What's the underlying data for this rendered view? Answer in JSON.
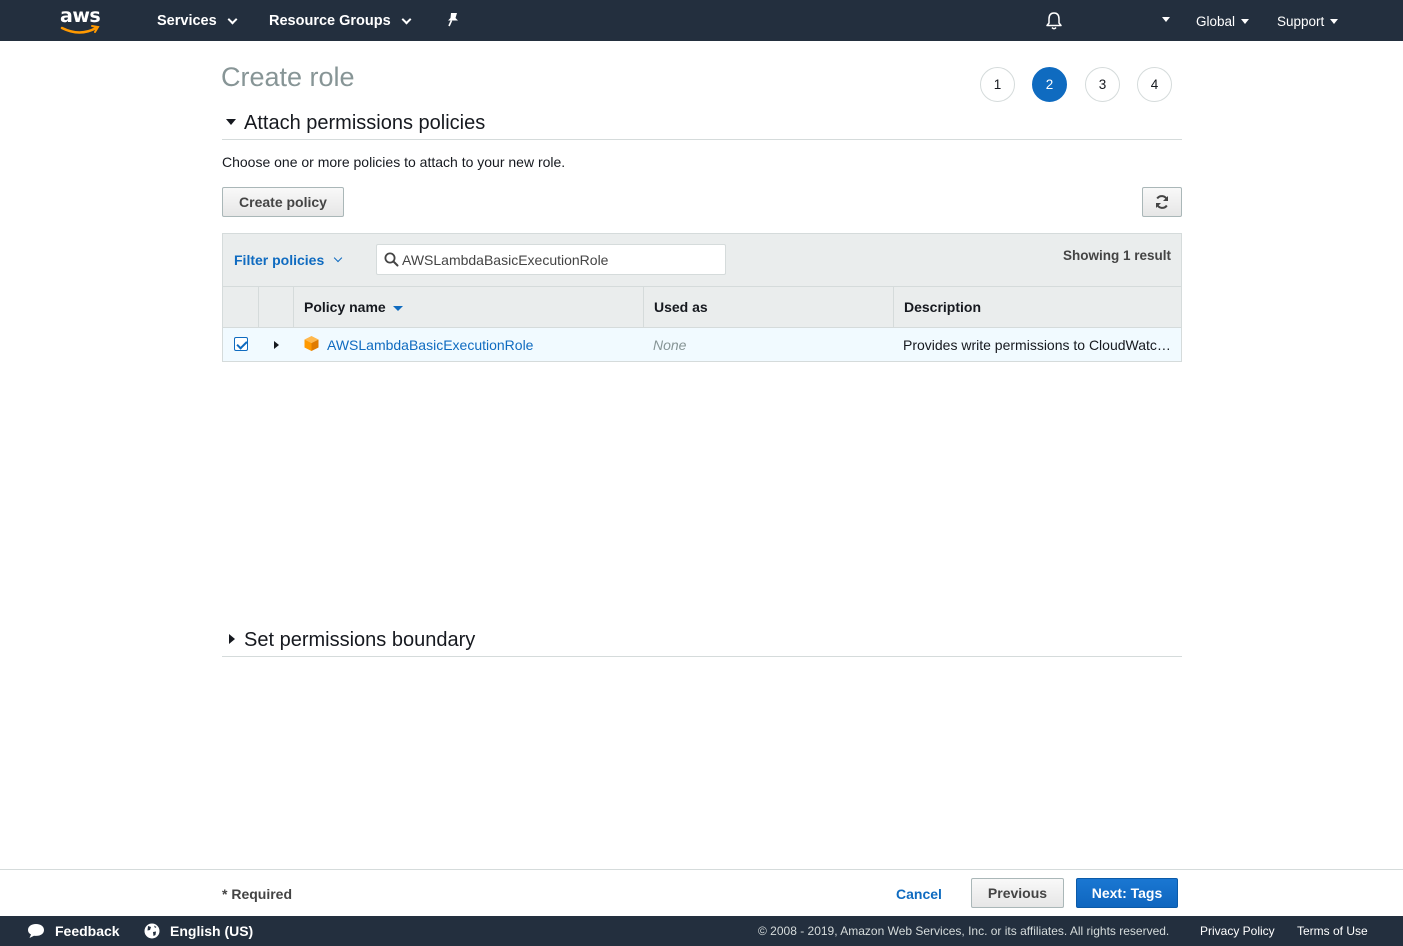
{
  "topnav": {
    "logo": "aws",
    "services": "Services",
    "resource_groups": "Resource Groups",
    "global": "Global",
    "support": "Support",
    "icons": [
      "pin-icon",
      "bell-icon"
    ]
  },
  "page": {
    "title": "Create role",
    "steps": [
      "1",
      "2",
      "3",
      "4"
    ],
    "active_step": "2"
  },
  "attach_section": {
    "heading": "Attach permissions policies",
    "intro": "Choose one or more policies to attach to your new role.",
    "create_policy": "Create policy",
    "filter_label": "Filter policies",
    "search_value": "AWSLambdaBasicExecutionRole",
    "result_count": "Showing 1 result",
    "columns": [
      "Policy name",
      "Used as",
      "Description"
    ],
    "rows": [
      {
        "checked": true,
        "name": "AWSLambdaBasicExecutionRole",
        "used_as": "None",
        "description": "Provides write permissions to CloudWatch Logs."
      }
    ]
  },
  "boundary_section": {
    "heading": "Set permissions boundary"
  },
  "footer": {
    "required": "* Required",
    "cancel": "Cancel",
    "previous": "Previous",
    "next": "Next: Tags"
  },
  "bottombar": {
    "feedback": "Feedback",
    "language": "English (US)",
    "copyright": "© 2008 - 2019, Amazon Web Services, Inc. or its affiliates. All rights reserved.",
    "privacy": "Privacy Policy",
    "terms": "Terms of Use"
  },
  "colors": {
    "nav_bg": "#232f3e",
    "accent": "#0f6bc0",
    "aws_orange": "#ff9900"
  }
}
